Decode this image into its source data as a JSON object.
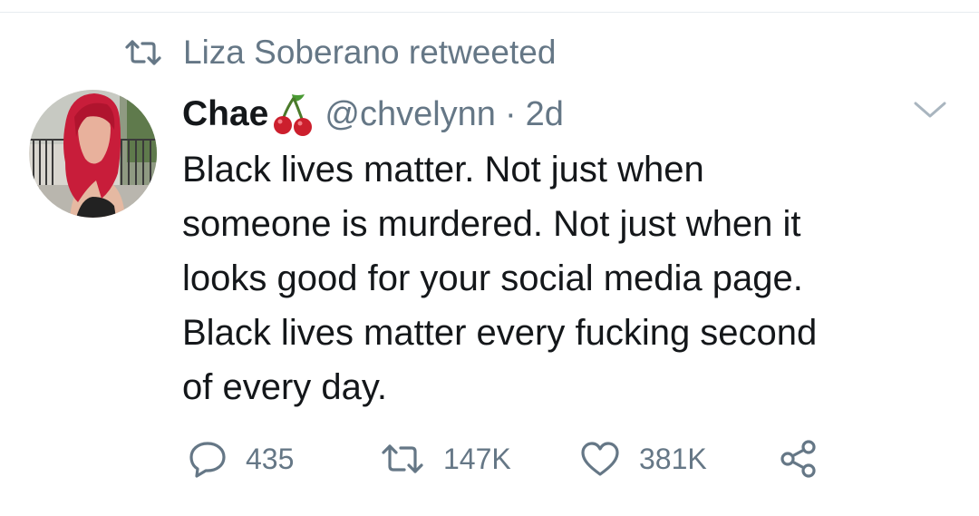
{
  "retweet": {
    "text": "Liza Soberano retweeted",
    "icon": "retweet-icon"
  },
  "tweet": {
    "author": {
      "display_name": "Chae",
      "emoji": "cherries-icon",
      "handle": "@chvelynn",
      "separator": "·",
      "time": "2d"
    },
    "text_lines": [
      "Black lives matter. Not just when",
      "someone is murdered. Not just when it",
      "looks good for your social media page.",
      "Black lives matter every fucking second",
      "of every day."
    ],
    "actions": {
      "reply_count": "435",
      "retweet_count": "147K",
      "like_count": "381K"
    }
  },
  "colors": {
    "text": "#14171a",
    "muted": "#657786",
    "divider": "#e6ecf0"
  },
  "icons": [
    "retweet-icon",
    "chevron-down-icon",
    "reply-icon",
    "heart-icon",
    "share-icon",
    "cherries-icon"
  ]
}
